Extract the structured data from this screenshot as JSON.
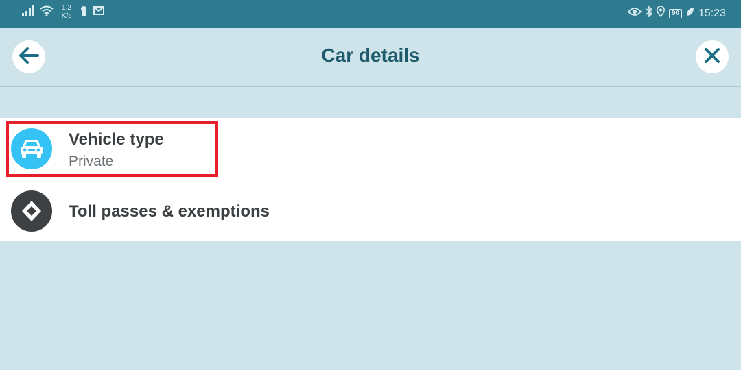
{
  "status_bar": {
    "net_speed_value": "1.2",
    "net_speed_unit": "K/s",
    "battery": "90",
    "time": "15:23",
    "icons": [
      "signal-icon",
      "wifi-icon",
      "keyhole-icon",
      "mail-icon",
      "eye-icon",
      "bluetooth-icon",
      "location-icon",
      "battery-icon",
      "leaf-icon"
    ]
  },
  "header": {
    "title": "Car details",
    "back_icon": "arrow-left-icon",
    "close_icon": "close-icon"
  },
  "list": {
    "items": [
      {
        "title": "Vehicle type",
        "subtitle": "Private",
        "icon": "car-icon",
        "icon_color": "#34c3f4"
      },
      {
        "title": "Toll passes & exemptions",
        "icon": "toll-diamond-icon",
        "icon_color": "#3e4143"
      }
    ]
  },
  "colors": {
    "status_bar": "#2e7b8f",
    "background": "#cfe3ea",
    "title": "#1d5a6b",
    "highlight": "#e5202b"
  }
}
